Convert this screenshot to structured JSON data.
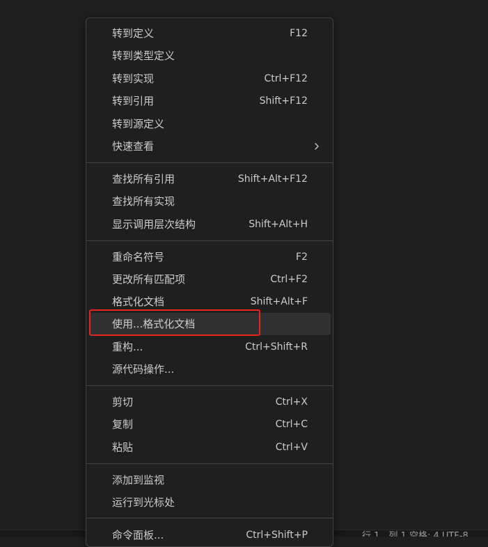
{
  "context_menu": {
    "groups": [
      [
        {
          "label": "转到定义",
          "shortcut": "F12"
        },
        {
          "label": "转到类型定义",
          "shortcut": ""
        },
        {
          "label": "转到实现",
          "shortcut": "Ctrl+F12"
        },
        {
          "label": "转到引用",
          "shortcut": "Shift+F12"
        },
        {
          "label": "转到源定义",
          "shortcut": ""
        },
        {
          "label": "快速查看",
          "shortcut": "",
          "submenu_icon": "chevron-right-icon"
        }
      ],
      [
        {
          "label": "查找所有引用",
          "shortcut": "Shift+Alt+F12"
        },
        {
          "label": "查找所有实现",
          "shortcut": ""
        },
        {
          "label": "显示调用层次结构",
          "shortcut": "Shift+Alt+H"
        }
      ],
      [
        {
          "label": "重命名符号",
          "shortcut": "F2"
        },
        {
          "label": "更改所有匹配项",
          "shortcut": "Ctrl+F2"
        },
        {
          "label": "格式化文档",
          "shortcut": "Shift+Alt+F"
        },
        {
          "label": "使用...格式化文档",
          "shortcut": "",
          "state": "hovered",
          "annotation": "red-highlight-box"
        },
        {
          "label": "重构...",
          "shortcut": "Ctrl+Shift+R"
        },
        {
          "label": "源代码操作...",
          "shortcut": ""
        }
      ],
      [
        {
          "label": "剪切",
          "shortcut": "Ctrl+X"
        },
        {
          "label": "复制",
          "shortcut": "Ctrl+C"
        },
        {
          "label": "粘贴",
          "shortcut": "Ctrl+V"
        }
      ],
      [
        {
          "label": "添加到监视",
          "shortcut": ""
        },
        {
          "label": "运行到光标处",
          "shortcut": ""
        }
      ],
      [
        {
          "label": "命令面板...",
          "shortcut": "Ctrl+Shift+P"
        }
      ]
    ]
  },
  "status_bar": {
    "text": "行 1，列 1   空格: 4   UTF-8"
  },
  "colors": {
    "background": "#1f1f1f",
    "menu_border": "#454545",
    "text": "#cccccc",
    "hover_background": "#323232",
    "highlight_annotation": "#e8261e"
  }
}
